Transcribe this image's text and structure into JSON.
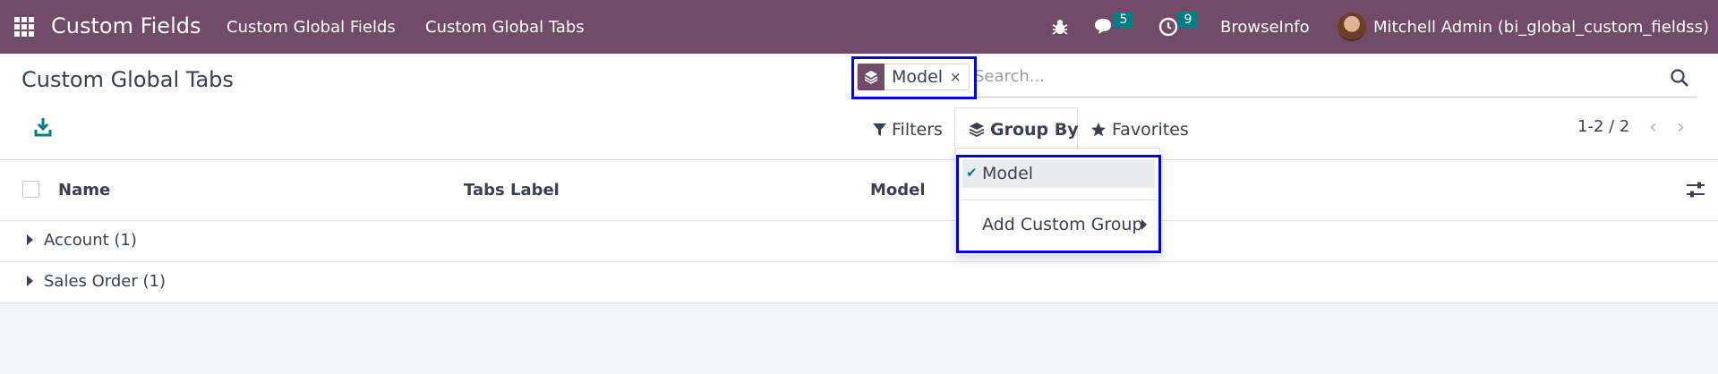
{
  "navbar": {
    "brand": "Custom Fields",
    "menu": [
      "Custom Global Fields",
      "Custom Global Tabs"
    ],
    "messages_count": "5",
    "activities_count": "9",
    "company": "BrowseInfo",
    "user": "Mitchell Admin (bi_global_custom_fieldss)",
    "icons": [
      "apps-grid-icon",
      "bug-icon",
      "chat-icon",
      "clock-icon"
    ]
  },
  "page": {
    "title": "Custom Global Tabs"
  },
  "search": {
    "facet_icon": "layers-icon",
    "facet_label": "Model",
    "facet_remove": "×",
    "placeholder": "Search..."
  },
  "toolbar": {
    "filters": "Filters",
    "group_by": "Group By",
    "favorites": "Favorites",
    "pager": "1-2 / 2"
  },
  "group_by_menu": {
    "selected_check": "✔",
    "selected": "Model",
    "add_custom_group": "Add Custom Group"
  },
  "list": {
    "columns": [
      "Name",
      "Tabs Label",
      "Model"
    ],
    "groups": [
      {
        "label": "Account (1)"
      },
      {
        "label": "Sales Order (1)"
      }
    ]
  },
  "colors": {
    "navbar": "#714b67",
    "accent": "#017e84",
    "highlight_box": "#0000e6"
  }
}
